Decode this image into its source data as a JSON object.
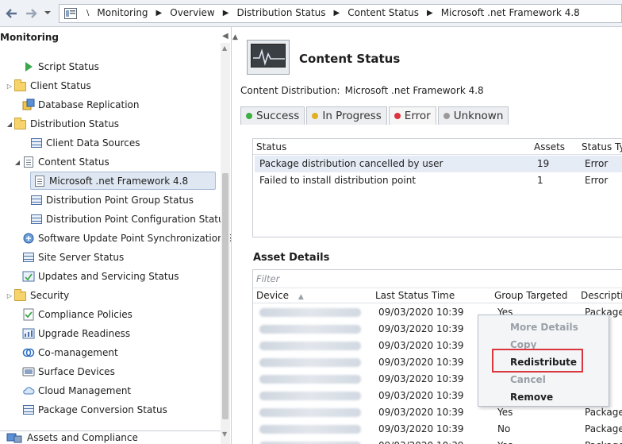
{
  "breadcrumb": {
    "root_sep": "\\",
    "items": [
      "Monitoring",
      "Overview",
      "Distribution Status",
      "Content Status",
      "Microsoft .net Framework 4.8"
    ]
  },
  "nav": {
    "header": "Monitoring",
    "items": [
      {
        "label": "Script Status",
        "icon": "script-icon"
      },
      {
        "label": "Client Status",
        "icon": "folder-icon"
      },
      {
        "label": "Database Replication",
        "icon": "database-icon"
      },
      {
        "label": "Distribution Status",
        "icon": "folder-icon"
      },
      {
        "label": "Client Data Sources",
        "icon": "data-sources-icon"
      },
      {
        "label": "Content Status",
        "icon": "content-status-icon"
      },
      {
        "label": "Microsoft .net Framework 4.8",
        "icon": "package-icon"
      },
      {
        "label": "Distribution Point Group Status",
        "icon": "dp-group-icon"
      },
      {
        "label": "Distribution Point Configuration Status",
        "icon": "dp-config-icon"
      },
      {
        "label": "Software Update Point Synchronization Sta",
        "icon": "sync-icon"
      },
      {
        "label": "Site Server Status",
        "icon": "server-icon"
      },
      {
        "label": "Updates and Servicing Status",
        "icon": "updates-icon"
      },
      {
        "label": "Security",
        "icon": "folder-icon"
      },
      {
        "label": "Compliance Policies",
        "icon": "compliance-icon"
      },
      {
        "label": "Upgrade Readiness",
        "icon": "upgrade-icon"
      },
      {
        "label": "Co-management",
        "icon": "co-management-icon"
      },
      {
        "label": "Surface Devices",
        "icon": "surface-icon"
      },
      {
        "label": "Cloud Management",
        "icon": "cloud-icon"
      },
      {
        "label": "Package Conversion Status",
        "icon": "package-conversion-icon"
      }
    ],
    "bottom_section": "Assets and Compliance"
  },
  "content": {
    "title": "Content Status",
    "subtitle_label": "Content Distribution:",
    "subtitle_value": "Microsoft .net Framework 4.8",
    "tabs": [
      {
        "label": "Success",
        "color": "#3cb043"
      },
      {
        "label": "In Progress",
        "color": "#e0b020"
      },
      {
        "label": "Error",
        "color": "#d9363e"
      },
      {
        "label": "Unknown",
        "color": "#9a9a9a"
      }
    ],
    "status_table": {
      "columns": [
        "Status",
        "Assets",
        "Status Typ"
      ],
      "rows": [
        {
          "status": "Package distribution cancelled by user",
          "assets": "19",
          "type": "Error"
        },
        {
          "status": "Failed to install distribution point",
          "assets": "1",
          "type": "Error"
        }
      ]
    },
    "asset_details": {
      "title": "Asset Details",
      "filter_placeholder": "Filter",
      "columns": [
        "Device",
        "Last Status Time",
        "Group Targeted",
        "Descripti"
      ],
      "rows": [
        {
          "time": "09/03/2020 10:39",
          "group": "Yes",
          "desc": "Package d"
        },
        {
          "time": "09/03/2020 10:39",
          "group": "",
          "desc": ""
        },
        {
          "time": "09/03/2020 10:39",
          "group": "",
          "desc": ""
        },
        {
          "time": "09/03/2020 10:39",
          "group": "",
          "desc": ""
        },
        {
          "time": "09/03/2020 10:39",
          "group": "",
          "desc": ""
        },
        {
          "time": "09/03/2020 10:39",
          "group": "",
          "desc": ""
        },
        {
          "time": "09/03/2020 10:39",
          "group": "Yes",
          "desc": "Package d"
        },
        {
          "time": "09/03/2020 10:39",
          "group": "No",
          "desc": "Package d"
        },
        {
          "time": "09/03/2020 10:39",
          "group": "Yes",
          "desc": "Package d"
        }
      ]
    }
  },
  "context_menu": {
    "items": [
      {
        "label": "More Details",
        "enabled": false
      },
      {
        "label": "Copy",
        "enabled": false
      },
      {
        "label": "Redistribute",
        "enabled": true
      },
      {
        "label": "Cancel",
        "enabled": false
      },
      {
        "label": "Remove",
        "enabled": true
      }
    ],
    "highlight_color": "#d9363e"
  }
}
